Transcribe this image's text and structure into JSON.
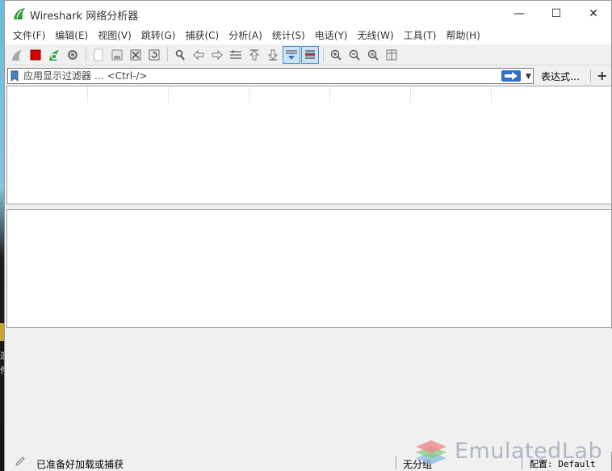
{
  "window": {
    "title": "Wireshark 网络分析器",
    "controls": {
      "minimize": "—",
      "maximize": "☐",
      "close": "✕"
    }
  },
  "menu": [
    {
      "label": "文件(F)",
      "accel": "F"
    },
    {
      "label": "编辑(E)",
      "accel": "E"
    },
    {
      "label": "视图(V)",
      "accel": "V"
    },
    {
      "label": "跳转(G)",
      "accel": "G"
    },
    {
      "label": "捕获(C)",
      "accel": "C"
    },
    {
      "label": "分析(A)",
      "accel": "A"
    },
    {
      "label": "统计(S)",
      "accel": "S"
    },
    {
      "label": "电话(Y)",
      "accel": "Y"
    },
    {
      "label": "无线(W)",
      "accel": "W"
    },
    {
      "label": "工具(T)",
      "accel": "T"
    },
    {
      "label": "帮助(H)",
      "accel": "H"
    }
  ],
  "toolbar": {
    "buttons": [
      "start-capture-icon",
      "stop-capture-icon",
      "restart-capture-icon",
      "capture-options-icon",
      "open-file-icon",
      "save-file-icon",
      "close-file-icon",
      "reload-file-icon",
      "find-packet-icon",
      "go-back-icon",
      "go-forward-icon",
      "go-to-packet-icon",
      "first-packet-icon",
      "last-packet-icon",
      "autoscroll-icon",
      "colorize-icon",
      "zoom-in-icon",
      "zoom-out-icon",
      "normal-size-icon",
      "resize-columns-icon"
    ]
  },
  "filter": {
    "placeholder": "应用显示过滤器 … <Ctrl-/>",
    "expression_label": "表达式…",
    "add_label": "+"
  },
  "status": {
    "ready": "已准备好加载或捕获",
    "profile_group": "无分组",
    "config": "配置: Default"
  },
  "watermark": "EmulatedLab",
  "colors": {
    "accent": "#4a90d0",
    "shark_green": "#2e9e3a",
    "stop_red": "#d40000",
    "apply_blue": "#2f6fce"
  }
}
